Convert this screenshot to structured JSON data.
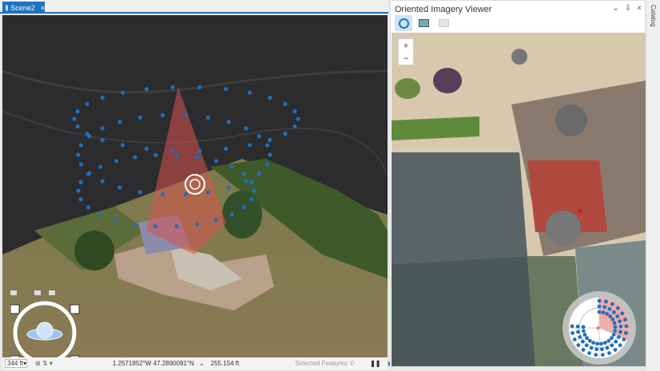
{
  "scene_tab": {
    "label": "Scene2",
    "close": "×"
  },
  "status": {
    "scale": "344 ft",
    "coords": "1.2571852°W 47.2890091°N",
    "elevation": "255.154 ft",
    "selected": "Selected Features: 0"
  },
  "viewer": {
    "title": "Oriented Imagery Viewer",
    "zoom_in": "+",
    "zoom_out": "−",
    "menu": "⌄",
    "pin": "⇩",
    "close": "×"
  },
  "catalog": {
    "label": "Catalog"
  },
  "colors": {
    "accent": "#1e73be",
    "point": "#1f6fbf",
    "frustum": "#d9534f"
  }
}
